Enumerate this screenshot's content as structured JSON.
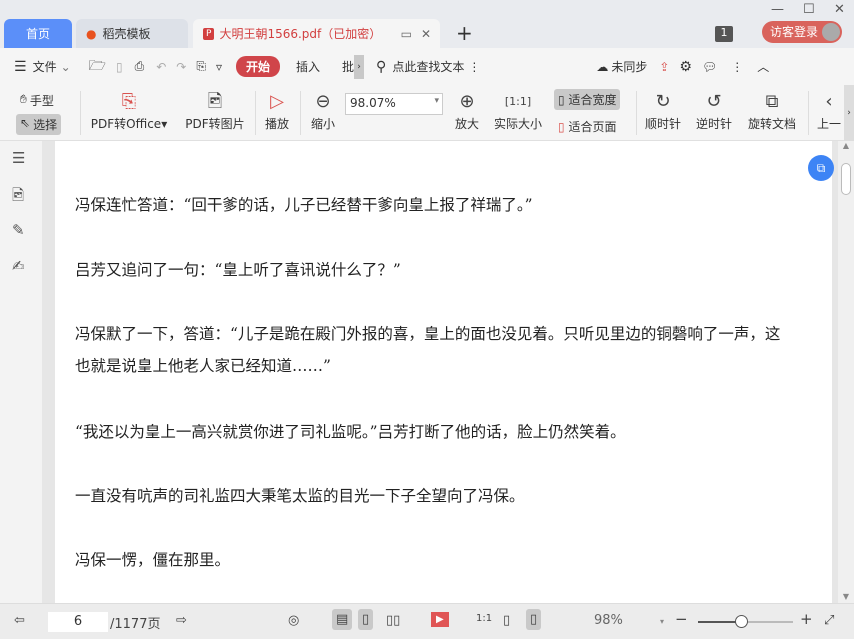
{
  "tabs": [
    {
      "label": "首页"
    },
    {
      "label": "稻壳模板"
    },
    {
      "label": "大明王朝1566.pdf（已加密）"
    }
  ],
  "header": {
    "badge": "1",
    "login": "访客登录"
  },
  "toolbar": {
    "file": "文件",
    "start": "开始",
    "insert": "插入",
    "annotate": "批",
    "search": "点此查找文本",
    "sync": "未同步"
  },
  "ribbon": {
    "hand": "手型",
    "select": "选择",
    "pdf_office": "PDF转Office",
    "pdf_image": "PDF转图片",
    "play": "播放",
    "zoom_out": "缩小",
    "zoom_value": "98.07%",
    "zoom_in": "放大",
    "actual_size": "实际大小",
    "fit_width": "适合宽度",
    "fit_page": "适合页面",
    "clockwise": "顺时针",
    "counterclockwise": "逆时针",
    "rotate_doc": "旋转文档",
    "prev": "上一"
  },
  "document": {
    "lines": [
      "冯保连忙答道：“回干爹的话，儿子已经替干爹向皇上报了祥瑞了。”",
      "吕芳又追问了一句：“皇上听了喜讯说什么了？”",
      "冯保默了一下，答道：“儿子是跪在殿门外报的喜，皇上的面也没见着。只听见里边的铜磬响了一声，这",
      "也就是说皇上他老人家已经知道……”",
      "“我还以为皇上一高兴就赏你进了司礼监呢。”吕芳打断了他的话，脸上仍然笑着。",
      "一直没有吭声的司礼监四大秉笔太监的目光一下子全望向了冯保。",
      "冯保一愣，僵在那里。"
    ]
  },
  "status": {
    "page": "6",
    "total": "/1177页",
    "zoom": "98%",
    "zoom_fraction": 0.45
  },
  "colors": {
    "accent": "#d9534f",
    "home_tab": "#5b8ff9"
  }
}
